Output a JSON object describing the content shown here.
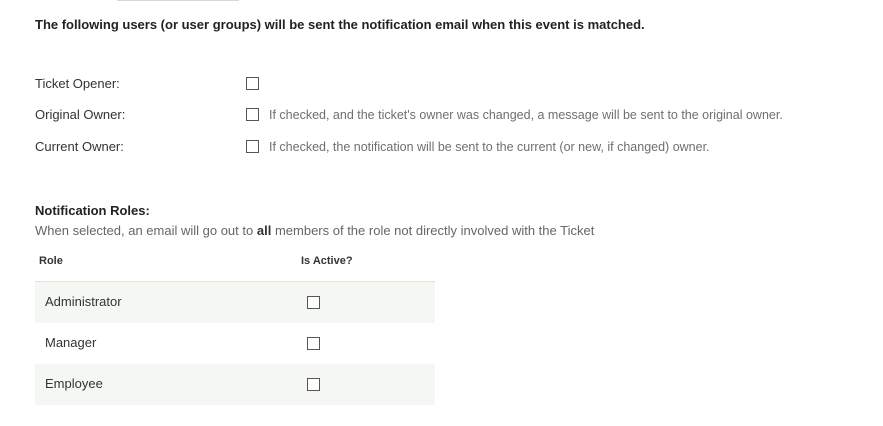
{
  "intro": "The following users (or user groups) will be sent the notification email when this event is matched.",
  "recipients": [
    {
      "label": "Ticket Opener:",
      "checked": false,
      "help": ""
    },
    {
      "label": "Original Owner:",
      "checked": false,
      "help": "If checked, and the ticket's owner was changed, a message will be sent to the original owner."
    },
    {
      "label": "Current Owner:",
      "checked": false,
      "help": "If checked, the notification will be sent to the current (or new, if changed) owner."
    }
  ],
  "roles": {
    "title": "Notification Roles:",
    "desc_before": "When selected, an email will go out to",
    "desc_bold": "all",
    "desc_after": "members of the role not directly involved with the Ticket",
    "columns": {
      "role": "Role",
      "active": "Is Active?"
    },
    "rows": [
      {
        "name": "Administrator",
        "active": false
      },
      {
        "name": "Manager",
        "active": false
      },
      {
        "name": "Employee",
        "active": false
      }
    ]
  },
  "colors": {
    "row_shade": "#f4f7f2",
    "help_text": "#6f6f6f"
  }
}
